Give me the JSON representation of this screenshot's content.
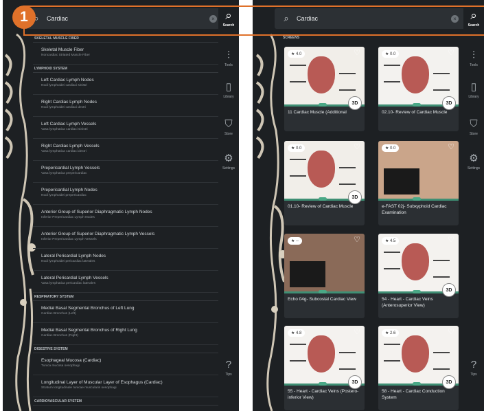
{
  "search_query": "Cardiac",
  "left_panel": {
    "rail": [
      {
        "icon": "search-icon",
        "label": "Search"
      },
      {
        "icon": "tools-icon",
        "label": "Tools"
      },
      {
        "icon": "library-icon",
        "label": "Library"
      },
      {
        "icon": "store-icon",
        "label": "Store"
      },
      {
        "icon": "settings-icon",
        "label": "Settings"
      },
      {
        "icon": "tips-icon",
        "label": "Tips"
      }
    ],
    "results": [
      {
        "kind": "section",
        "title": "SKELETAL MUSCLE FIBER"
      },
      {
        "kind": "item",
        "title": "Skeletal Muscle Fiber",
        "sub": "Noncardiac Striated Muscle Fiber"
      },
      {
        "kind": "section",
        "title": "LYMPHOID SYSTEM"
      },
      {
        "kind": "item",
        "title": "Left Cardiac Lymph Nodes",
        "sub": "Nodi lymphoidei cardiaci sinistri"
      },
      {
        "kind": "item",
        "title": "Right Cardiac Lymph Nodes",
        "sub": "Nodi lymphoidei cardiaci dextri"
      },
      {
        "kind": "item",
        "title": "Left Cardiac Lymph Vessels",
        "sub": "Vasa lymphatica cardiaci sinistri"
      },
      {
        "kind": "item",
        "title": "Right Cardiac Lymph Vessels",
        "sub": "Vasa lymphatica cardiaci dextri"
      },
      {
        "kind": "item",
        "title": "Prepericardial Lymph Vessels",
        "sub": "Vasa lymphatica prepericardiac"
      },
      {
        "kind": "item",
        "title": "Prepericardial Lymph Nodes",
        "sub": "Nodi lymphoidei prepericardiac"
      },
      {
        "kind": "item",
        "title": "Anterior Group of Superior Diaphragmatic Lymph Nodes",
        "sub": "Inferior Prepericardiac Lymph Nodes"
      },
      {
        "kind": "item",
        "title": "Anterior Group of Superior Diaphragmatic Lymph Vessels",
        "sub": "Inferior Prepericardiac Lymph Vessels"
      },
      {
        "kind": "item",
        "title": "Lateral Pericardial Lymph Nodes",
        "sub": "Nodi lymphoidei pericardiac laterales"
      },
      {
        "kind": "item",
        "title": "Lateral Pericardial Lymph Vessels",
        "sub": "Vasa lymphatica pericardiac laterales"
      },
      {
        "kind": "section",
        "title": "RESPIRATORY SYSTEM"
      },
      {
        "kind": "item",
        "title": "Medial Basal Segmental Bronchus of Left Lung",
        "sub": "Cardiac Bronchus (Left)"
      },
      {
        "kind": "item",
        "title": "Medial Basal Segmental Bronchus of Right Lung",
        "sub": "Cardiac Bronchus (Right)"
      },
      {
        "kind": "section",
        "title": "DIGESTIVE SYSTEM"
      },
      {
        "kind": "item",
        "title": "Esophageal Mucosa (Cardiac)",
        "sub": "Tunica mucosa oesophagi"
      },
      {
        "kind": "item",
        "title": "Longitudinal Layer of Muscular Layer of Esophagus (Cardiac)",
        "sub": "Stratum longitudinale tunicae muscularis oesophagi"
      },
      {
        "kind": "section",
        "title": "CARDIOVASCULAR SYSTEM"
      }
    ]
  },
  "right_panel": {
    "section_label": "SCREENS",
    "rail": [
      {
        "icon": "search-icon",
        "label": "Search"
      },
      {
        "icon": "tools-icon",
        "label": "Tools"
      },
      {
        "icon": "library-icon",
        "label": "Library"
      },
      {
        "icon": "store-icon",
        "label": "Store"
      },
      {
        "icon": "settings-icon",
        "label": "Settings"
      },
      {
        "icon": "tips-icon",
        "label": "Tips"
      }
    ],
    "cards": [
      {
        "rating": "4.0",
        "title": "11 Cardiac Muscle (Additional",
        "badge": "3D"
      },
      {
        "rating": "0.0",
        "title": "02.10- Review of Cardiac Muscle",
        "badge": "3D"
      },
      {
        "rating": "0.0",
        "title": "01.10- Review of Cardiac Muscle",
        "badge": "3D"
      },
      {
        "rating": "0.0",
        "title": "e-FAST 02j- Subxyphoid Cardiac Examination",
        "badge": ""
      },
      {
        "rating": "--",
        "title": "Echo 04g- Subcostal Cardiac View",
        "badge": ""
      },
      {
        "rating": "4.5",
        "title": "54 - Heart - Cardiac Veins (Anterosuperior View)",
        "badge": "3D"
      },
      {
        "rating": "4.8",
        "title": "55 - Heart - Cardiac Veins (Postero-inferior View)",
        "badge": "3D"
      },
      {
        "rating": "2.6",
        "title": "58 - Heart - Cardiac Conduction System",
        "badge": "3D"
      }
    ]
  },
  "step_number": "1",
  "colors": {
    "accent": "#e0712a",
    "panel": "#1d2023",
    "green": "#3f8f74"
  }
}
